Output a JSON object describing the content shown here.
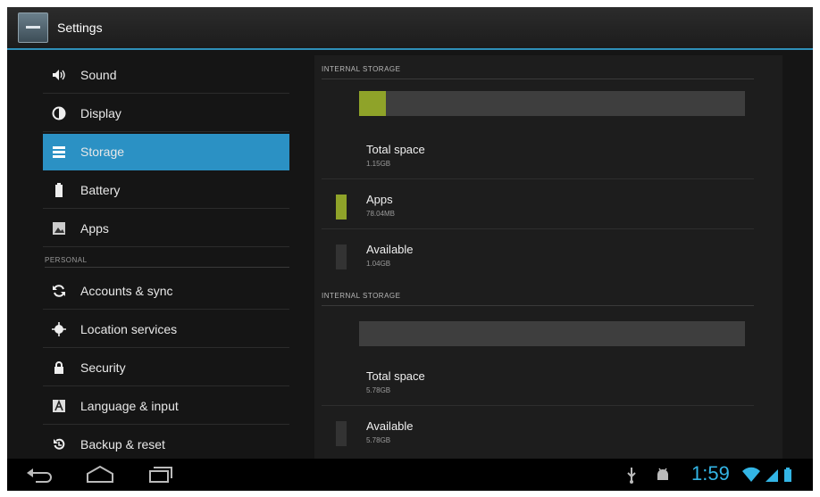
{
  "actionbar": {
    "title": "Settings",
    "icon": "settings-app-icon"
  },
  "menu": {
    "items": [
      {
        "label": "Sound",
        "icon": "speaker-icon"
      },
      {
        "label": "Display",
        "icon": "display-brightness-icon"
      },
      {
        "label": "Storage",
        "icon": "storage-icon",
        "active": true
      },
      {
        "label": "Battery",
        "icon": "battery-icon"
      },
      {
        "label": "Apps",
        "icon": "apps-icon"
      }
    ],
    "personal_header": "PERSONAL",
    "personal_items": [
      {
        "label": "Accounts & sync",
        "icon": "sync-icon"
      },
      {
        "label": "Location services",
        "icon": "location-icon"
      },
      {
        "label": "Security",
        "icon": "lock-icon"
      },
      {
        "label": "Language & input",
        "icon": "language-icon"
      },
      {
        "label": "Backup & reset",
        "icon": "backup-icon"
      }
    ]
  },
  "storage": {
    "sections": [
      {
        "header": "INTERNAL STORAGE",
        "used_fraction": 0.07,
        "total_label": "Total space",
        "total_value": "1.15GB",
        "apps_label": "Apps",
        "apps_value": "78.04MB",
        "available_label": "Available",
        "available_value": "1.04GB"
      },
      {
        "header": "INTERNAL STORAGE",
        "used_fraction": 0.0,
        "total_label": "Total space",
        "total_value": "5.78GB",
        "available_label": "Available",
        "available_value": "5.78GB"
      }
    ]
  },
  "sysbar": {
    "time": "1:59"
  },
  "colors": {
    "accent": "#33b5e5",
    "selected": "#2b91c4",
    "apps": "#8fa329"
  }
}
